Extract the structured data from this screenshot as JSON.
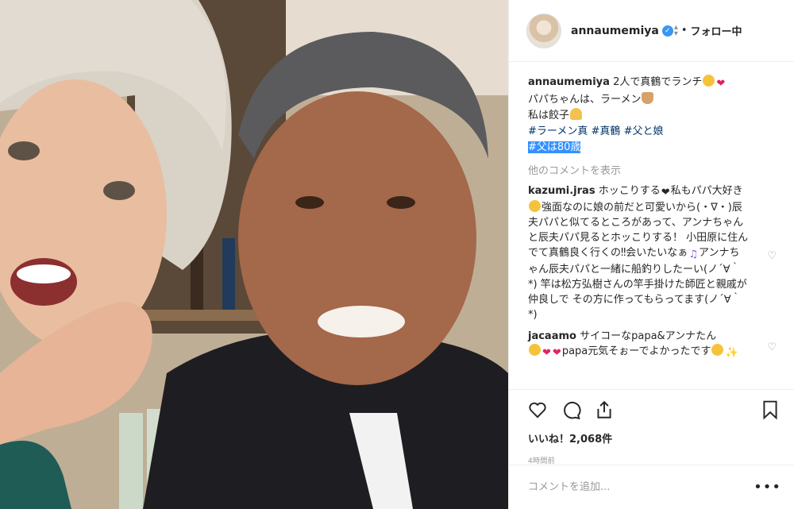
{
  "header": {
    "username": "annaumemiya",
    "separator": "•",
    "follow_label": "フォロー中"
  },
  "caption": {
    "username": "annaumemiya",
    "line1_text": "2人で真鶴でランチ",
    "line2_text": "パパちゃんは、ラーメン",
    "line3_text": "私は餃子",
    "tags_line1": [
      "#ラーメン真",
      "#真鶴",
      "#父と娘"
    ],
    "tag_selected": "#父は80歳"
  },
  "more_comments_label": "他のコメントを表示",
  "comments": [
    {
      "username": "kazumi.jras",
      "text_a": "ホッこりする",
      "text_b": "私もパパ大好き",
      "text_c": "強面なのに娘の前だと可愛いから(・∇・)辰夫パパと似てるところがあって、アンナちゃんと辰夫パパ見るとホッこりする！ 小田原に住んでて真鶴良く行くの‼会いたいなぁ",
      "text_d": "アンナちゃん辰夫パパと一緒に船釣りしたーい(ノ´∀｀*) 竿は松方弘樹さんの竿手掛けた師匠と親戚が仲良しで その方に作ってもらってます(ノ´∀｀*)"
    },
    {
      "username": "jacaamo",
      "text_a": "サイコーなpapa&アンナたん",
      "text_b": "papa元気そぉーでよかったです"
    }
  ],
  "likes": "いいね！2,068件",
  "time": "4時間前",
  "add_comment_placeholder": "コメントを追加...",
  "options_label": "•••",
  "icons": {
    "verified": "verified-badge-icon",
    "like": "heart-icon",
    "comment": "speech-bubble-icon",
    "share": "share-icon",
    "bookmark": "bookmark-icon"
  },
  "colors": {
    "tag": "#003569",
    "selection": "#3390ff",
    "verified": "#3897f0",
    "muted": "#999999"
  }
}
